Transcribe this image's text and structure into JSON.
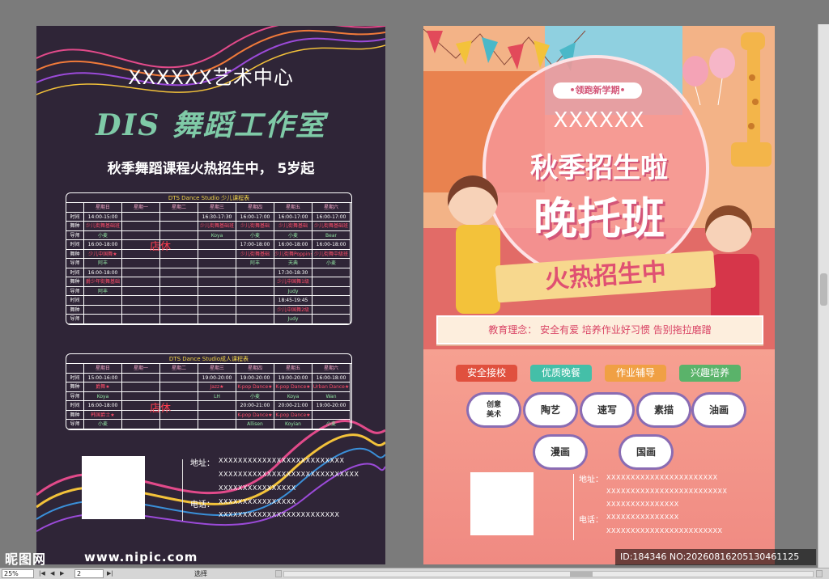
{
  "left_flyer": {
    "center_name": "XXXXXX艺术中心",
    "studio_title": "DIS 舞蹈工作室",
    "subtitle": "秋季舞蹈课程火热招生中，  5岁起",
    "kids_schedule": {
      "title": "DTS Dance Studio 少儿课程表",
      "days": [
        "星期日",
        "星期一",
        "星期二",
        "星期三",
        "星期四",
        "星期五",
        "星期六"
      ],
      "row_labels": [
        "时间",
        "舞种",
        "导师",
        "时间",
        "舞种",
        "导师",
        "时间",
        "舞种",
        "导师",
        "时间",
        "舞种",
        "导师"
      ],
      "sunday": [
        "14:00-15:00",
        "少儿街舞基础班",
        "小麦",
        "16:00-18:00",
        "少儿中国舞★",
        "阿丰",
        "16:00-18:00",
        "爵少年街舞基础",
        "阿丰",
        "",
        "",
        ""
      ],
      "wednesday": [
        "16:30-17:30",
        "少儿街舞基础班",
        "Koya",
        "",
        "",
        "",
        "",
        "",
        "",
        "",
        "",
        ""
      ],
      "thursday": [
        "16:00-17:00",
        "少儿街舞基础",
        "小麦",
        "17:00-18:00",
        "少儿街舞基础",
        "阿丰",
        "",
        "",
        "",
        "",
        "",
        ""
      ],
      "friday": [
        "16:00-17:00",
        "少儿街舞基础",
        "小麦",
        "16:00-18:00",
        "少儿街舞Poppin★",
        "天典",
        "17:30-18:30",
        "少儿中国舞1级",
        "Judy",
        "18:45-19:45",
        "少儿中国舞2级",
        "Judy"
      ],
      "saturday": [
        "16:00-17:00",
        "少儿街舞基础班",
        "Bear",
        "16:00-18:00",
        "少儿街舞中级班",
        "小麦",
        "",
        "",
        "",
        "",
        "",
        ""
      ],
      "closed_label": "店休"
    },
    "adult_schedule": {
      "title": "DTS Dance Studio成人课程表",
      "days": [
        "星期日",
        "星期一",
        "星期二",
        "星期三",
        "星期四",
        "星期五",
        "星期六"
      ],
      "row_labels": [
        "时间",
        "舞种",
        "导师",
        "时间",
        "舞种",
        "导师"
      ],
      "sunday": [
        "15:00-16:00",
        "爵舞★",
        "Koya",
        "16:00-18:00",
        "韩国爵士★",
        "小麦"
      ],
      "wednesday": [
        "19:00-20:00",
        "Jazz★",
        "LH",
        "",
        "",
        ""
      ],
      "thursday": [
        "19:00-20:00",
        "K-pop Dance★",
        "小麦",
        "20:00-21:00",
        "K-pop Dance★",
        "Allisen"
      ],
      "friday": [
        "19:00-20:00",
        "K-pop Dance★",
        "Koya",
        "20:00-21:00",
        "K-pop Dance★",
        "Koyian"
      ],
      "saturday": [
        "16:00-18:00",
        "Urban Dance★",
        "Wan",
        "19:00-20:00",
        "",
        "小麦"
      ],
      "closed_label": "店休"
    },
    "address_label": "地址：",
    "address_lines": [
      "XXXXXXXXXXXXXXXXXXXXXXXXXX",
      "XXXXXXXXXXXXXXXXXXXXXXXXXXXXX",
      "XXXXXXXXXXXXXXXX"
    ],
    "phone_label": "电话：",
    "phone_lines": [
      "XXXXXXXXXXXXXXXX",
      "XXXXXXXXXXXXXXXXXXXXXXXXX"
    ]
  },
  "right_flyer": {
    "badge": "•领跑新学期•",
    "name": "XXXXXX",
    "headline1": "秋季招生啦",
    "headline2": "晚托班",
    "ribbon": "火热招生中",
    "philosophy": "教育理念：  安全有爱  培养作业好习惯  告别拖拉磨蹭",
    "features": [
      "安全接校",
      "优质晚餐",
      "作业辅导",
      "兴趣培养"
    ],
    "feature_colors": [
      "#e0503e",
      "#44bfa8",
      "#f0a044",
      "#5ab36a"
    ],
    "courses_row1_first_line1": "创意",
    "courses_row1_first_line2": "美术",
    "courses": [
      "陶艺",
      "速写",
      "素描",
      "油画",
      "漫画",
      "国画"
    ],
    "address_label": "地址：",
    "address_lines": [
      "XXXXXXXXXXXXXXXXXXXXXXX",
      "XXXXXXXXXXXXXXXXXXXXXXXXX",
      "XXXXXXXXXXXXXXX"
    ],
    "phone_label": "电话：",
    "phone_lines": [
      "XXXXXXXXXXXXXXX",
      "XXXXXXXXXXXXXXXXXXXXXXXX"
    ]
  },
  "watermark": {
    "logo": "昵图网",
    "url": "www.nipic.com",
    "id": "ID:184346 NO:20260816205130461125"
  },
  "statusbar": {
    "zoom": "25%",
    "page": "2",
    "mode": "选择",
    "nav_first": "|◀",
    "nav_prev": "◀",
    "nav_next": "▶",
    "nav_last": "▶|"
  }
}
